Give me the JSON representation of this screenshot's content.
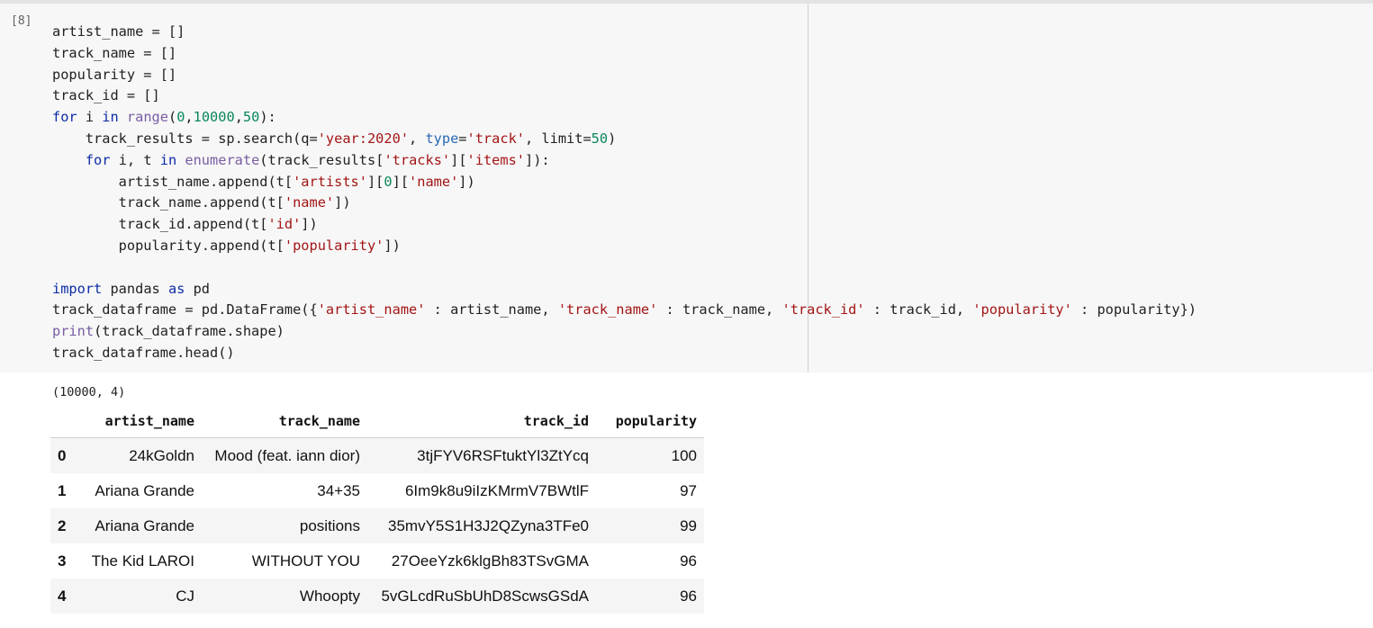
{
  "cell": {
    "execution_count": "[8]",
    "code_lines": [
      [
        [
          "v",
          "artist_name = []"
        ]
      ],
      [
        [
          "v",
          "track_name = []"
        ]
      ],
      [
        [
          "v",
          "popularity = []"
        ]
      ],
      [
        [
          "v",
          "track_id = []"
        ]
      ],
      [
        [
          "kw",
          "for"
        ],
        [
          "v",
          " i "
        ],
        [
          "kw",
          "in"
        ],
        [
          "v",
          " "
        ],
        [
          "bi",
          "range"
        ],
        [
          "v",
          "("
        ],
        [
          "num",
          "0"
        ],
        [
          "v",
          ","
        ],
        [
          "num",
          "10000"
        ],
        [
          "v",
          ","
        ],
        [
          "num",
          "50"
        ],
        [
          "v",
          "):"
        ]
      ],
      [
        [
          "v",
          "    track_results = sp.search(q="
        ],
        [
          "str",
          "'year:2020'"
        ],
        [
          "v",
          ", "
        ],
        [
          "prm",
          "type"
        ],
        [
          "v",
          "="
        ],
        [
          "str",
          "'track'"
        ],
        [
          "v",
          ", limit="
        ],
        [
          "num",
          "50"
        ],
        [
          "v",
          ")"
        ]
      ],
      [
        [
          "v",
          "    "
        ],
        [
          "kw",
          "for"
        ],
        [
          "v",
          " i, t "
        ],
        [
          "kw",
          "in"
        ],
        [
          "v",
          " "
        ],
        [
          "bi",
          "enumerate"
        ],
        [
          "v",
          "(track_results["
        ],
        [
          "str",
          "'tracks'"
        ],
        [
          "v",
          "]["
        ],
        [
          "str",
          "'items'"
        ],
        [
          "v",
          "]):"
        ]
      ],
      [
        [
          "v",
          "        artist_name.append(t["
        ],
        [
          "str",
          "'artists'"
        ],
        [
          "v",
          "]["
        ],
        [
          "num",
          "0"
        ],
        [
          "v",
          "]["
        ],
        [
          "str",
          "'name'"
        ],
        [
          "v",
          "])"
        ]
      ],
      [
        [
          "v",
          "        track_name.append(t["
        ],
        [
          "str",
          "'name'"
        ],
        [
          "v",
          "])"
        ]
      ],
      [
        [
          "v",
          "        track_id.append(t["
        ],
        [
          "str",
          "'id'"
        ],
        [
          "v",
          "])"
        ]
      ],
      [
        [
          "v",
          "        popularity.append(t["
        ],
        [
          "str",
          "'popularity'"
        ],
        [
          "v",
          "])"
        ]
      ],
      [
        [
          "v",
          ""
        ]
      ],
      [
        [
          "kw",
          "import"
        ],
        [
          "v",
          " pandas "
        ],
        [
          "kw",
          "as"
        ],
        [
          "v",
          " pd"
        ]
      ],
      [
        [
          "v",
          "track_dataframe = pd.DataFrame({"
        ],
        [
          "str",
          "'artist_name'"
        ],
        [
          "v",
          " : artist_name, "
        ],
        [
          "str",
          "'track_name'"
        ],
        [
          "v",
          " : track_name, "
        ],
        [
          "str",
          "'track_id'"
        ],
        [
          "v",
          " : track_id, "
        ],
        [
          "str",
          "'popularity'"
        ],
        [
          "v",
          " : popularity})"
        ]
      ],
      [
        [
          "bi",
          "print"
        ],
        [
          "v",
          "(track_dataframe.shape)"
        ]
      ],
      [
        [
          "v",
          "track_dataframe.head()"
        ]
      ]
    ]
  },
  "output": {
    "shape_text": "(10000, 4)",
    "table": {
      "columns": [
        "",
        "artist_name",
        "track_name",
        "track_id",
        "popularity"
      ],
      "rows": [
        [
          "0",
          "24kGoldn",
          "Mood (feat. iann dior)",
          "3tjFYV6RSFtuktYl3ZtYcq",
          "100"
        ],
        [
          "1",
          "Ariana Grande",
          "34+35",
          "6Im9k8u9iIzKMrmV7BWtlF",
          "97"
        ],
        [
          "2",
          "Ariana Grande",
          "positions",
          "35mvY5S1H3J2QZyna3TFe0",
          "99"
        ],
        [
          "3",
          "The Kid LAROI",
          "WITHOUT YOU",
          "27OeeYzk6klgBh83TSvGMA",
          "96"
        ],
        [
          "4",
          "CJ",
          "Whoopty",
          "5vGLcdRuSbUhD8ScwsGSdA",
          "96"
        ]
      ]
    }
  },
  "colors": {
    "keyword": "#0d2ca5",
    "builtin": "#795da3",
    "string": "#a31515",
    "number": "#098658",
    "param": "#2a68b6",
    "cell_bg": "#f7f7f7"
  }
}
